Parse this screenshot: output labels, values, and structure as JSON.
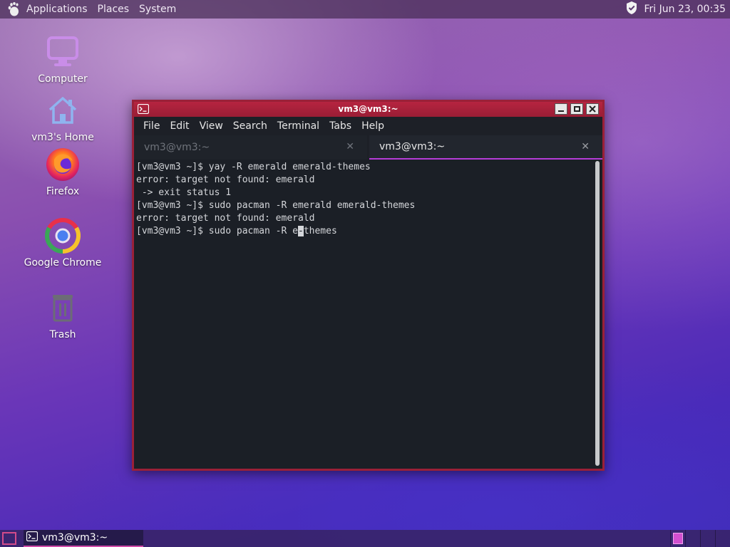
{
  "top_panel": {
    "menus": [
      "Applications",
      "Places",
      "System"
    ],
    "clock": "Fri Jun 23, 00:35"
  },
  "desktop_icons": [
    {
      "label": "Computer",
      "icon": "computer-icon"
    },
    {
      "label": "vm3's Home",
      "icon": "home-folder-icon"
    },
    {
      "label": "Firefox",
      "icon": "firefox-icon"
    },
    {
      "label": "Google Chrome",
      "icon": "chrome-icon"
    },
    {
      "label": "Trash",
      "icon": "trash-icon"
    }
  ],
  "terminal": {
    "title": "vm3@vm3:~",
    "menu": [
      "File",
      "Edit",
      "View",
      "Search",
      "Terminal",
      "Tabs",
      "Help"
    ],
    "tabs": [
      {
        "label": "vm3@vm3:~",
        "active": false
      },
      {
        "label": "vm3@vm3:~",
        "active": true
      }
    ],
    "lines": [
      "[vm3@vm3 ~]$ yay -R emerald emerald-themes",
      "error: target not found: emerald",
      " -> exit status 1",
      "[vm3@vm3 ~]$ sudo pacman -R emerald emerald-themes",
      "error: target not found: emerald"
    ],
    "current_line": {
      "before_cursor": "[vm3@vm3 ~]$ sudo pacman -R e",
      "cursor_char": "-",
      "after_cursor": "themes"
    }
  },
  "taskbar": {
    "task_label": "vm3@vm3:~",
    "workspace_count": 4,
    "active_workspace": 1
  },
  "colors": {
    "titlebar": "#b62440",
    "accent": "#b63cd8"
  }
}
